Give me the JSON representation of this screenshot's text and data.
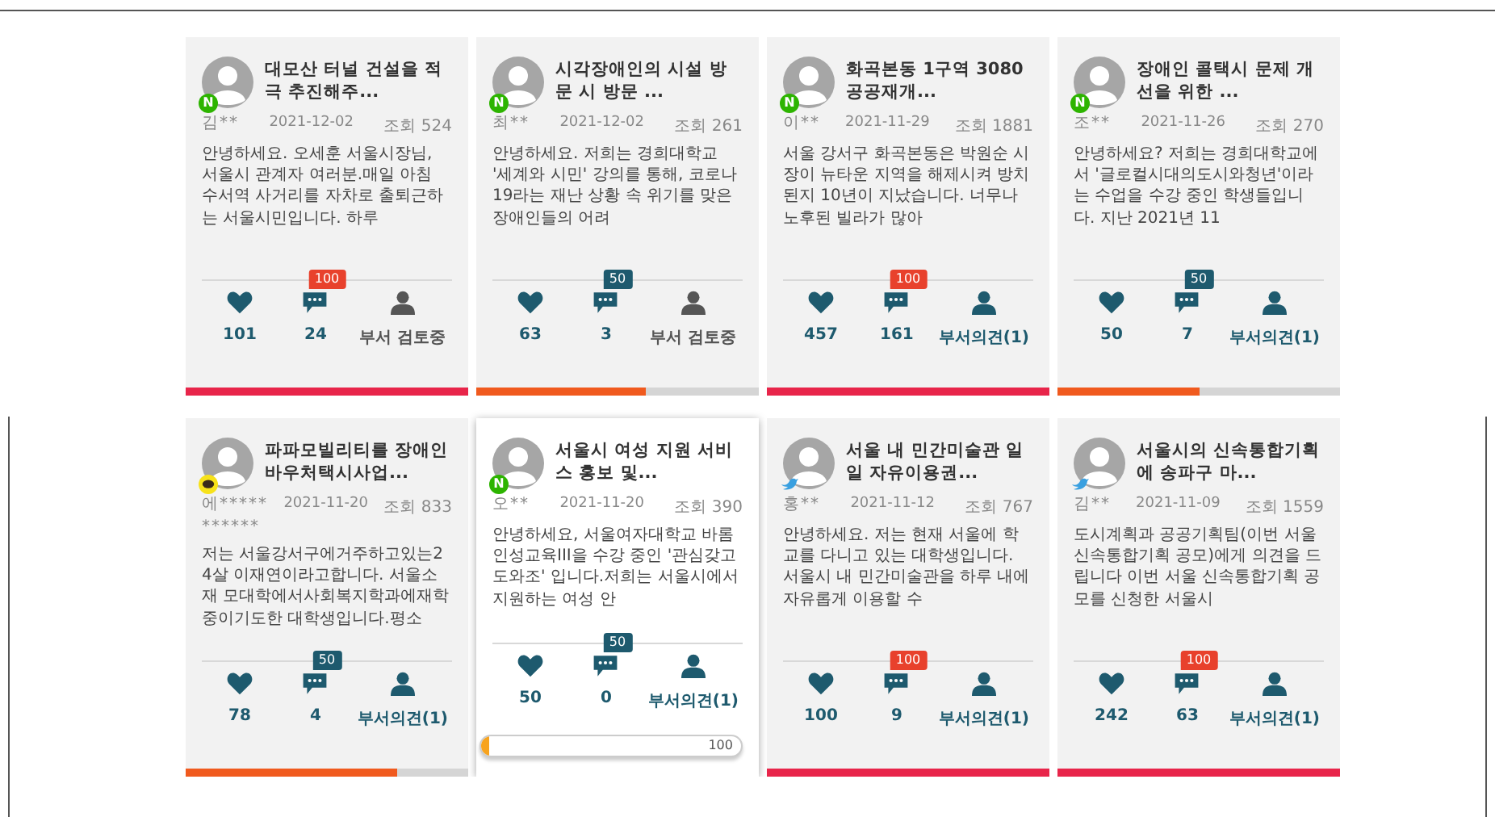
{
  "cards": [
    {
      "title": "대모산 터널 건설을 적극 추진해주...",
      "login": {
        "kind": "naver",
        "label": "N"
      },
      "author": "김**",
      "date": "2021-12-02",
      "views": "조회 524",
      "body": "안녕하세요. 오세훈 서울시장님, 서울시 관계자 여러분.매일 아침 수서역 사거리를 자차로 출퇴근하는 서울시민입니다. 하루",
      "badge": {
        "label": "100",
        "color": "#e8412c"
      },
      "likes": "101",
      "comments": "24",
      "status": {
        "kind": "review",
        "label": "부서 검토중"
      },
      "hovered": false,
      "level": 1
    },
    {
      "title": "시각장애인의 시설 방문 시 방문 ...",
      "login": {
        "kind": "naver",
        "label": "N"
      },
      "author": "최**",
      "date": "2021-12-02",
      "views": "조회 261",
      "body": "안녕하세요. 저희는 경희대학교 '세계와 시민' 강의를 통해, 코로나19라는 재난 상황 속 위기를 맞은 장애인들의 어려",
      "badge": {
        "label": "50",
        "color": "#1e5a6e"
      },
      "likes": "63",
      "comments": "3",
      "status": {
        "kind": "review",
        "label": "부서 검토중"
      },
      "hovered": false,
      "level": 0.6
    },
    {
      "title": "화곡본동 1구역 3080 공공재개...",
      "login": {
        "kind": "naver",
        "label": "N"
      },
      "author": "이**",
      "date": "2021-11-29",
      "views": "조회 1881",
      "body": "서울 강서구 화곡본동은 박원순 시장이 뉴타운 지역을 해제시켜 방치된지 10년이 지났습니다. 너무나 노후된 빌라가 많아",
      "badge": {
        "label": "100",
        "color": "#e8412c"
      },
      "likes": "457",
      "comments": "161",
      "status": {
        "kind": "opinion",
        "label": "부서의견(1)"
      },
      "hovered": false,
      "level": 1
    },
    {
      "title": "장애인 콜택시 문제 개선을 위한 ...",
      "login": {
        "kind": "naver",
        "label": "N"
      },
      "author": "조**",
      "date": "2021-11-26",
      "views": "조회 270",
      "body": "안녕하세요? 저희는 경희대학교에서 '글로컬시대의도시와청년'이라는 수업을 수강 중인 학생들입니다. 지난 2021년 11",
      "badge": {
        "label": "50",
        "color": "#1e5a6e"
      },
      "likes": "50",
      "comments": "7",
      "status": {
        "kind": "opinion",
        "label": "부서의견(1)"
      },
      "hovered": false,
      "level": 0.5
    },
    {
      "title": "파파모빌리티를 장애인바우처택시사업...",
      "login": {
        "kind": "kakao"
      },
      "author": "에*****",
      "author_more": "******",
      "date": "2021-11-20",
      "views": "조회 833",
      "body": "저는 서울강서구에거주하고있는24살 이재연이라고합니다. 서울소재 모대학에서사회복지학과에재학중이기도한 대학생입니다.평소",
      "badge": {
        "label": "50",
        "color": "#1e5a6e"
      },
      "likes": "78",
      "comments": "4",
      "status": {
        "kind": "opinion",
        "label": "부서의견(1)"
      },
      "hovered": false,
      "level": 0.75
    },
    {
      "title": "서울시 여성 지원 서비스 홍보 및...",
      "login": {
        "kind": "naver",
        "label": "N"
      },
      "author": "오**",
      "date": "2021-11-20",
      "views": "조회 390",
      "body": "안녕하세요, 서울여자대학교 바롬인성교육III을 수강 중인 '관심갖고 도와조' 입니다.저희는 서울시에서 지원하는 여성 안",
      "badge": {
        "label": "50",
        "color": "#1e5a6e"
      },
      "likes": "50",
      "comments": "0",
      "status": {
        "kind": "opinion",
        "label": "부서의견(1)"
      },
      "hovered": true,
      "goal": "100",
      "level": 0.03
    },
    {
      "title": "서울 내 민간미술관 일일 자유이용권...",
      "login": {
        "kind": "twitter"
      },
      "author": "홍**",
      "date": "2021-11-12",
      "views": "조회 767",
      "body": "안녕하세요. 저는 현재 서울에 학교를 다니고 있는 대학생입니다. 서울시 내 민간미술관을 하루 내에 자유롭게 이용할 수",
      "badge": {
        "label": "100",
        "color": "#e8412c"
      },
      "likes": "100",
      "comments": "9",
      "status": {
        "kind": "opinion",
        "label": "부서의견(1)"
      },
      "hovered": false,
      "level": 1
    },
    {
      "title": "서울시의 신속통합기획에 송파구 마...",
      "login": {
        "kind": "twitter"
      },
      "author": "김**",
      "date": "2021-11-09",
      "views": "조회 1559",
      "body": "도시계획과 공공기획팀(이번 서울 신속통합기획 공모)에게 의견을 드립니다 이번 서울 신속통합기획 공모를 신청한 서울시",
      "badge": {
        "label": "100",
        "color": "#e8412c"
      },
      "likes": "242",
      "comments": "63",
      "status": {
        "kind": "opinion",
        "label": "부서의견(1)"
      },
      "hovered": false,
      "level": 1
    }
  ]
}
